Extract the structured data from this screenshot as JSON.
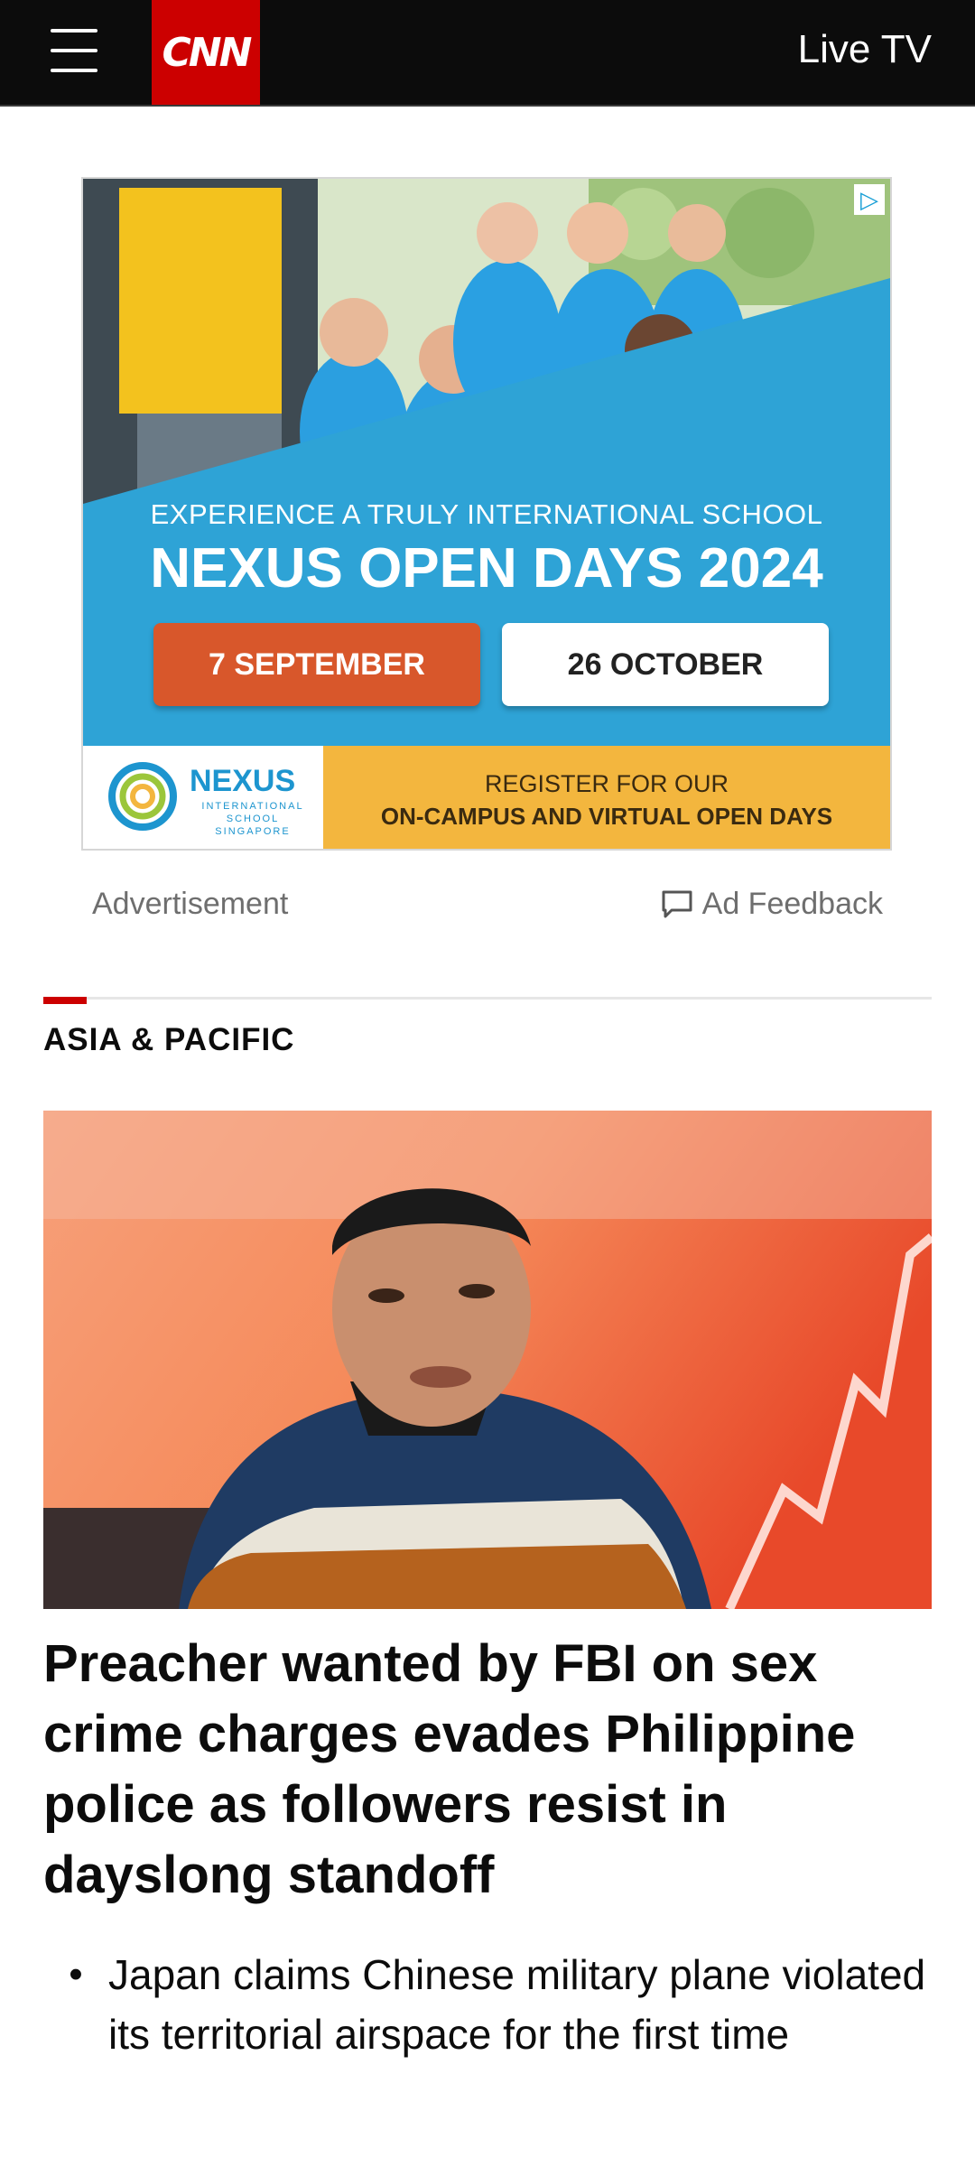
{
  "header": {
    "logo_text": "CNN",
    "live_tv_label": "Live TV",
    "icons": {
      "menu": "hamburger-menu-icon"
    }
  },
  "ad": {
    "tagline": "EXPERIENCE A TRULY INTERNATIONAL SCHOOL",
    "headline": "NEXUS OPEN DAYS 2024",
    "date_buttons": [
      "7 SEPTEMBER",
      "26 OCTOBER"
    ],
    "logo_name": "NEXUS",
    "logo_sub": "INTERNATIONAL SCHOOL SINGAPORE",
    "register_line1": "REGISTER FOR OUR",
    "register_line2": "ON-CAMPUS AND VIRTUAL OPEN DAYS",
    "choices_icon": "adchoices-icon",
    "colors": {
      "blue": "#2ea3d6",
      "orange": "#d8572b",
      "yellow": "#f3b63e"
    }
  },
  "ad_meta": {
    "advertisement_label": "Advertisement",
    "feedback_label": "Ad Feedback",
    "feedback_icon": "comment-icon"
  },
  "section": {
    "label": "ASIA & PACIFIC",
    "accent_color": "#cc0000"
  },
  "story": {
    "headline": "Preacher wanted by FBI on sex crime charges evades Philippine police as followers resist in dayslong standoff",
    "related": [
      {
        "text": "Japan claims Chinese military plane violated its territorial airspace for the first time"
      }
    ]
  }
}
